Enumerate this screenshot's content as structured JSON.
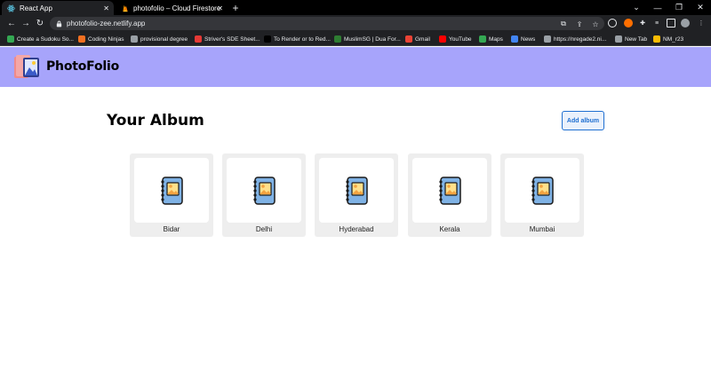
{
  "browser": {
    "tabs": [
      {
        "label": "React App",
        "active": true
      },
      {
        "label": "photofolio – Cloud Firestore – Fir",
        "active": false
      }
    ],
    "url": "photofolio-zee.netlify.app",
    "bookmarks": [
      {
        "label": "Create a Sudoku So...",
        "color": "#34a853"
      },
      {
        "label": "Coding Ninjas",
        "color": "#f37021"
      },
      {
        "label": "provisional degree",
        "color": "#9aa0a6"
      },
      {
        "label": "Striver's SDE Sheet...",
        "color": "#e53935"
      },
      {
        "label": "To Render or to Red...",
        "color": "#000000"
      },
      {
        "label": "MuslimSG | Dua For...",
        "color": "#2e7d32"
      },
      {
        "label": "Gmail",
        "color": "#ea4335"
      },
      {
        "label": "YouTube",
        "color": "#ff0000"
      },
      {
        "label": "Maps",
        "color": "#34a853"
      },
      {
        "label": "News",
        "color": "#4285f4"
      },
      {
        "label": "https://nregade2.ni...",
        "color": "#9aa0a6"
      },
      {
        "label": "New Tab",
        "color": "#9aa0a6"
      },
      {
        "label": "NM_r23",
        "color": "#fbbc04"
      }
    ]
  },
  "app": {
    "brand": "PhotoFolio",
    "header_color": "#a7a4fb"
  },
  "main": {
    "title": "Your Album",
    "add_button_label": "Add album",
    "albums": [
      {
        "name": "Bidar"
      },
      {
        "name": "Delhi"
      },
      {
        "name": "Hyderabad"
      },
      {
        "name": "Kerala"
      },
      {
        "name": "Mumbai"
      }
    ]
  }
}
